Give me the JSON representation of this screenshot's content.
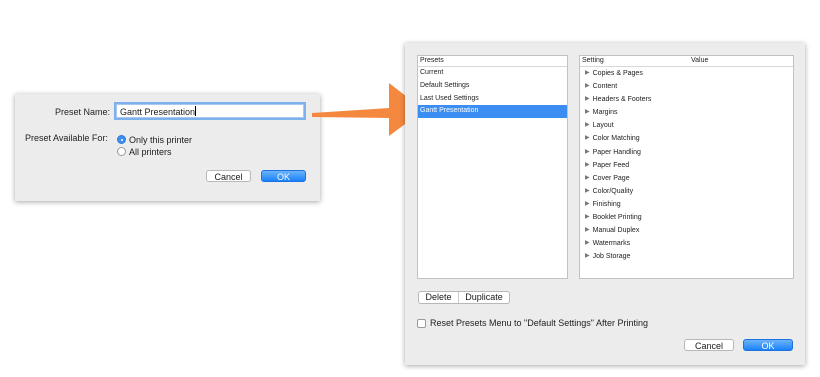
{
  "save_dialog": {
    "name_label": "Preset Name:",
    "name_value": "Gantt Presentation",
    "available_label": "Preset Available For:",
    "options": [
      {
        "label": "Only this printer",
        "selected": true
      },
      {
        "label": "All printers",
        "selected": false
      }
    ],
    "cancel_label": "Cancel",
    "ok_label": "OK"
  },
  "arrow": {
    "color": "#f5883f",
    "icon": "right-arrow-icon"
  },
  "presets_dialog": {
    "presets_header": "Presets",
    "presets": [
      {
        "label": "Current",
        "selected": false
      },
      {
        "label": "Default Settings",
        "selected": false
      },
      {
        "label": "Last Used Settings",
        "selected": false
      },
      {
        "label": "Gantt Presentation",
        "selected": true
      }
    ],
    "setting_header": "Setting",
    "value_header": "Value",
    "settings": [
      "Copies & Pages",
      "Content",
      "Headers & Footers",
      "Margins",
      "Layout",
      "Color Matching",
      "Paper Handling",
      "Paper Feed",
      "Cover Page",
      "Color/Quality",
      "Finishing",
      "Booklet Printing",
      "Manual Duplex",
      "Watermarks",
      "Job Storage"
    ],
    "delete_label": "Delete",
    "duplicate_label": "Duplicate",
    "reset_label": "Reset Presets Menu to \"Default Settings\" After Printing",
    "reset_checked": false,
    "cancel_label": "Cancel",
    "ok_label": "OK"
  },
  "colors": {
    "accent": "#3b8df1",
    "arrow": "#f5883f",
    "dialog_bg": "#ececec"
  }
}
